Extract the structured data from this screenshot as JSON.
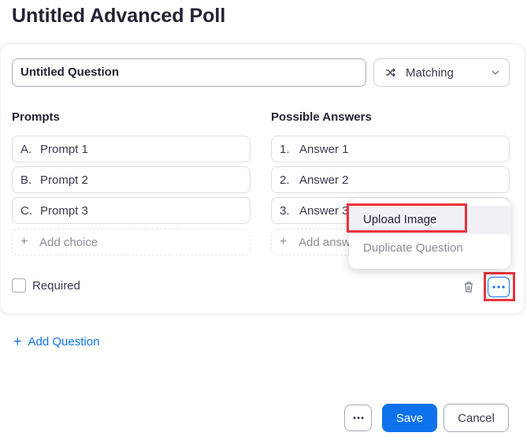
{
  "poll": {
    "title": "Untitled Advanced Poll"
  },
  "question": {
    "title_value": "Untitled Question",
    "type_value": "Matching",
    "prompts_heading": "Prompts",
    "answers_heading": "Possible Answers",
    "prompts": [
      {
        "index": "A.",
        "label": "Prompt 1"
      },
      {
        "index": "B.",
        "label": "Prompt 2"
      },
      {
        "index": "C.",
        "label": "Prompt 3"
      }
    ],
    "answers": [
      {
        "index": "1.",
        "label": "Answer 1"
      },
      {
        "index": "2.",
        "label": "Answer 2"
      },
      {
        "index": "3.",
        "label": "Answer 3"
      }
    ],
    "add_choice_label": "Add choice",
    "add_answer_label": "Add answ",
    "required_label": "Required",
    "required_checked": false
  },
  "more_menu": {
    "items": [
      {
        "label": "Upload Image"
      },
      {
        "label": "Duplicate Question"
      }
    ]
  },
  "actions": {
    "add_question_label": "Add Question",
    "save_label": "Save",
    "cancel_label": "Cancel"
  },
  "colors": {
    "accent": "#0e72ed",
    "highlight": "#e8333b",
    "text": "#232333"
  },
  "icons": {
    "type_select": "shuffle-icon",
    "type_chevron": "chevron-down-icon",
    "delete": "trash-icon",
    "more": "ellipsis-icon",
    "add": "plus-icon"
  }
}
